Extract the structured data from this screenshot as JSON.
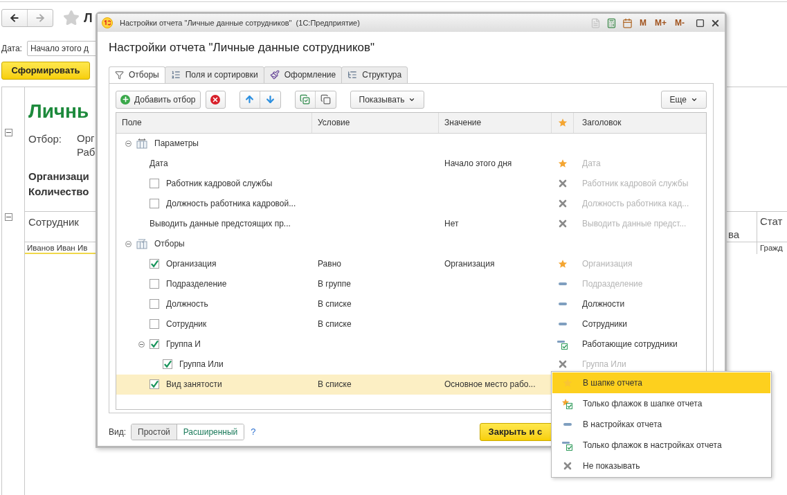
{
  "page": {
    "nav_title": "Л",
    "date_label": "Дата:",
    "date_value": "Начало этого д",
    "generate_button": "Сформировать",
    "report": {
      "title": "Личнь",
      "filter_label": "Отбор:",
      "filter_lines": [
        "Орг",
        "Раб"
      ],
      "summary": [
        "Организаци",
        "Количество"
      ],
      "columns": [
        "Сотрудник",
        "ва",
        "Стат"
      ],
      "rows": [
        [
          "Иванов Иван Ив",
          "",
          "Гражд"
        ]
      ]
    }
  },
  "dialog": {
    "title": "Настройки отчета \"Личные данные сотрудников\"  (1С:Предприятие)",
    "memory_buttons": [
      "M",
      "M+",
      "M-"
    ],
    "heading": "Настройки отчета \"Личные данные сотрудников\"",
    "tabs": [
      {
        "label": "Отборы",
        "kind": "filter",
        "selected": true
      },
      {
        "label": "Поля и сортировки",
        "kind": "fields",
        "selected": false
      },
      {
        "label": "Оформление",
        "kind": "brush",
        "selected": false
      },
      {
        "label": "Структура",
        "kind": "tree",
        "selected": false
      }
    ],
    "toolbar": {
      "add": "Добавить отбор",
      "show": "Показывать",
      "more": "Еще"
    },
    "columns": [
      "Поле",
      "Условие",
      "Значение",
      "Заголовок"
    ],
    "rows": [
      {
        "kind": "group",
        "field": "Параметры",
        "expanded": true,
        "children": [
          {
            "kind": "star",
            "field": "Дата",
            "value": "Начало этого дня",
            "header": "Дата",
            "dimmed": true,
            "selected": false
          },
          {
            "kind": "cross",
            "field": "Работник кадровой службы",
            "checked": false,
            "header": "Работник кадровой службы",
            "dimmed": true,
            "selected": false
          },
          {
            "kind": "cross",
            "field": "Должность работника кадровой...",
            "checked": false,
            "header": "Должность работника кад...",
            "dimmed": true,
            "selected": false
          },
          {
            "kind": "cross",
            "field": "Выводить данные предстоящих пр...",
            "value": "Нет",
            "header": "Выводить данные предст...",
            "dimmed": true,
            "selected": false
          }
        ]
      },
      {
        "kind": "group",
        "field": "Отборы",
        "expanded": true,
        "children": [
          {
            "kind": "star",
            "field": "Организация",
            "checked": true,
            "condition": "Равно",
            "value": "Организация",
            "header": "Организация",
            "dimmed": true,
            "selected": false
          },
          {
            "kind": "dash",
            "field": "Подразделение",
            "checked": false,
            "condition": "В группе",
            "header": "Подразделение",
            "dimmed": true,
            "selected": false
          },
          {
            "kind": "dash",
            "field": "Должность",
            "checked": false,
            "condition": "В списке",
            "header": "Должности",
            "dimmed": false,
            "selected": false
          },
          {
            "kind": "dash",
            "field": "Сотрудник",
            "checked": false,
            "condition": "В списке",
            "header": "Сотрудники",
            "dimmed": false,
            "selected": false
          },
          {
            "kind": "flag",
            "field": "Группа И",
            "checked": true,
            "expanded": true,
            "header": "Работающие сотрудники",
            "dimmed": false,
            "selected": false,
            "children": [
              {
                "kind": "cross",
                "field": "Группа Или",
                "checked": true,
                "header": "Группа Или",
                "dimmed": true,
                "selected": false
              }
            ]
          },
          {
            "kind": "covered",
            "field": "Вид занятости",
            "checked": true,
            "condition": "В списке",
            "value": "Основное место рабо...",
            "selected": true
          }
        ]
      }
    ],
    "footer": {
      "view_label": "Вид:",
      "views": [
        {
          "label": "Простой",
          "selected": false
        },
        {
          "label": "Расширенный",
          "selected": true
        }
      ],
      "help": "?",
      "close_button": "Закрыть и с"
    }
  },
  "menu": {
    "items": [
      {
        "label": "В шапке отчета",
        "kind": "star",
        "selected": true
      },
      {
        "label": "Только флажок в шапке отчета",
        "kind": "star-flag",
        "selected": false
      },
      {
        "label": "В настройках отчета",
        "kind": "dash",
        "selected": false
      },
      {
        "label": "Только флажок в настройках отчета",
        "kind": "dash-flag",
        "selected": false
      },
      {
        "label": "Не показывать",
        "kind": "cross",
        "selected": false
      }
    ]
  }
}
